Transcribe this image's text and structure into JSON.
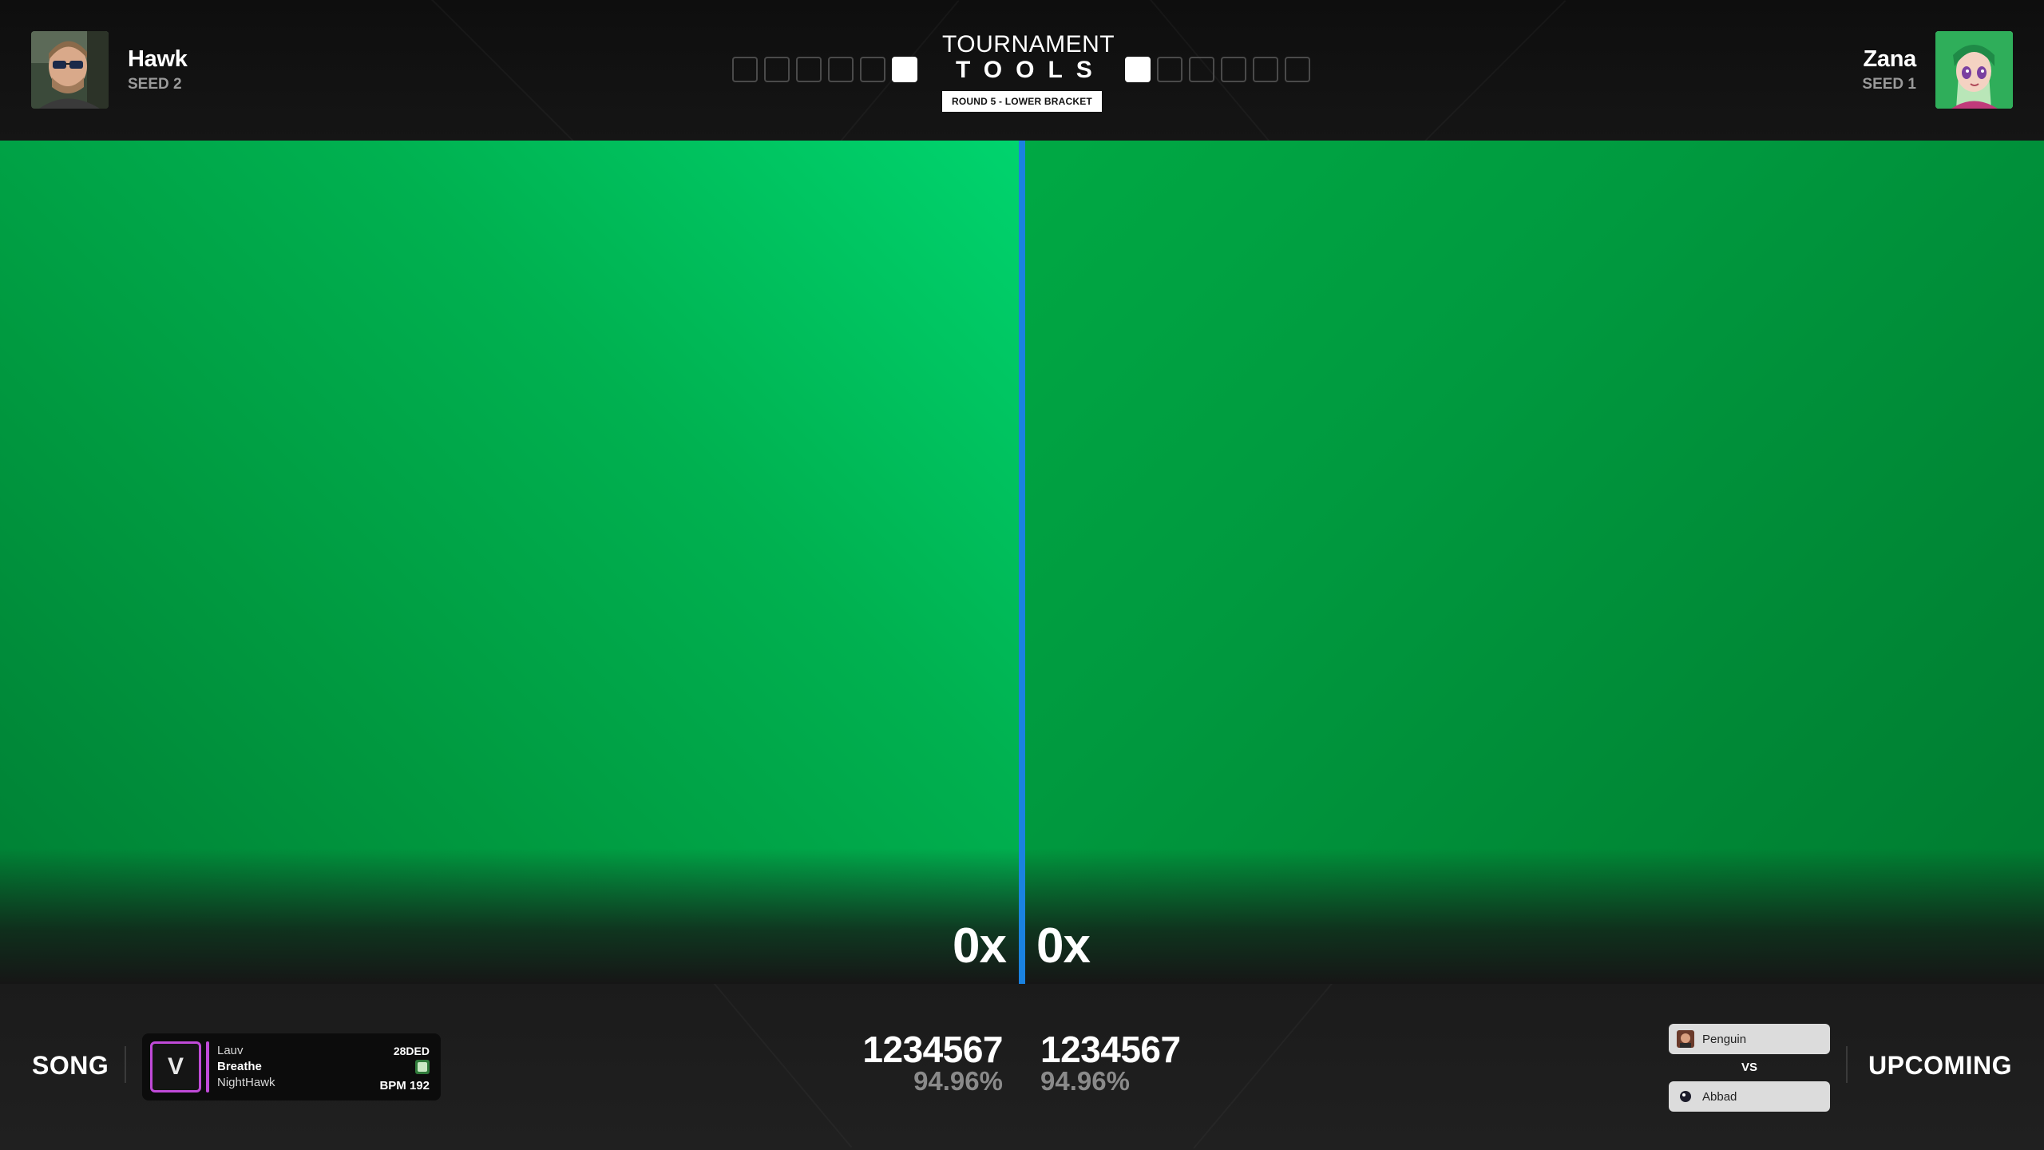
{
  "top": {
    "left_player": {
      "name": "Hawk",
      "seed": "SEED 2",
      "score_boxes": [
        false,
        false,
        false,
        false,
        false,
        true
      ]
    },
    "right_player": {
      "name": "Zana",
      "seed": "SEED 1",
      "score_boxes": [
        true,
        false,
        false,
        false,
        false,
        false
      ]
    },
    "logo": {
      "line1": "TOURNAMENT",
      "line2": "TOOLS"
    },
    "round": "ROUND 5 - LOWER BRACKET"
  },
  "gameplay": {
    "left_combo": "0x",
    "right_combo": "0x",
    "divider_color": "#1a82e0",
    "stream_bg": "#00b150"
  },
  "bottom": {
    "song_label": "SONG",
    "upcoming_label": "UPCOMING",
    "song": {
      "cover_glyph": "V",
      "artist": "Lauv",
      "title": "Breathe",
      "mapper": "NightHawk",
      "diff": "28DED",
      "bpm": "BPM 192",
      "accent": "#c04ad8"
    },
    "left_score": {
      "points": "1234567",
      "accuracy": "94.96%"
    },
    "right_score": {
      "points": "1234567",
      "accuracy": "94.96%"
    },
    "upcoming": {
      "player1": "Penguin",
      "vs": "VS",
      "player2": "Abbad"
    }
  }
}
